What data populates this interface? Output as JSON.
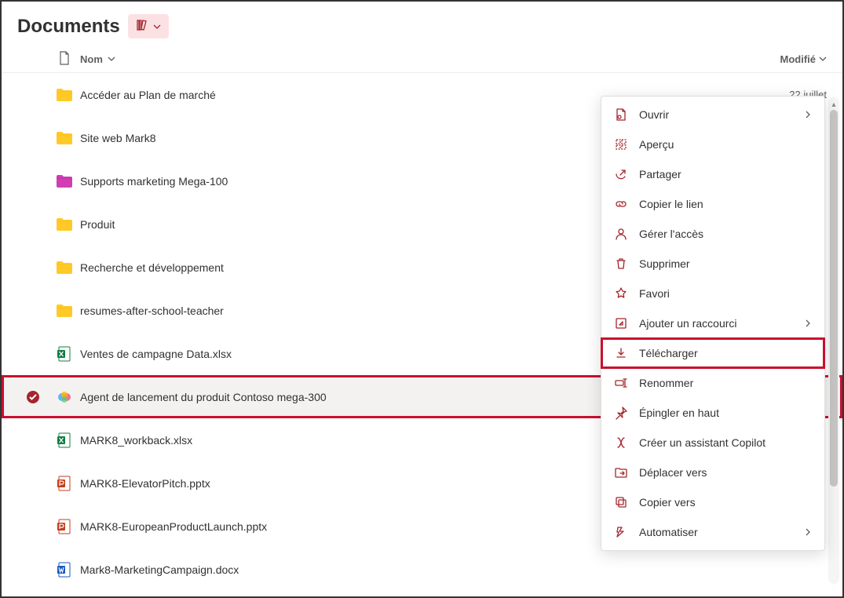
{
  "header": {
    "title": "Documents"
  },
  "columns": {
    "name": "Nom",
    "modified": "Modifié"
  },
  "rows": [
    {
      "icon": "folder-yellow",
      "name": "Accéder au Plan de marché",
      "modified": "22 juillet",
      "selected": false,
      "highlighted": false
    },
    {
      "icon": "folder-yellow",
      "name": "Site web Mark8",
      "modified": "",
      "selected": false,
      "highlighted": false
    },
    {
      "icon": "folder-magenta",
      "name": "Supports marketing Mega-100",
      "modified": "",
      "selected": false,
      "highlighted": false
    },
    {
      "icon": "folder-yellow",
      "name": "Produit",
      "modified": "",
      "selected": false,
      "highlighted": false
    },
    {
      "icon": "folder-yellow",
      "name": "Recherche et développement",
      "modified": "",
      "selected": false,
      "highlighted": false
    },
    {
      "icon": "folder-yellow",
      "name": "resumes-after-school-teacher",
      "modified": "",
      "selected": false,
      "highlighted": false
    },
    {
      "icon": "excel",
      "name": "Ventes de campagne Data.xlsx",
      "modified": "",
      "selected": false,
      "highlighted": false
    },
    {
      "icon": "copilot",
      "name": "Agent de lancement du produit Contoso mega-300",
      "modified": "",
      "selected": true,
      "highlighted": true,
      "showEllipsis": true
    },
    {
      "icon": "excel",
      "name": "MARK8_workback.xlsx",
      "modified": "",
      "selected": false,
      "highlighted": false
    },
    {
      "icon": "powerpoint",
      "name": "MARK8-ElevatorPitch.pptx",
      "modified": "",
      "selected": false,
      "highlighted": false
    },
    {
      "icon": "powerpoint",
      "name": "MARK8-EuropeanProductLaunch.pptx",
      "modified": "",
      "selected": false,
      "highlighted": false
    },
    {
      "icon": "word",
      "name": "Mark8-MarketingCampaign.docx",
      "modified": "",
      "selected": false,
      "highlighted": false
    }
  ],
  "contextMenu": {
    "items": [
      {
        "icon": "open-icon",
        "label": "Ouvrir",
        "chevron": true,
        "highlighted": false
      },
      {
        "icon": "preview-icon",
        "label": "Aperçu",
        "chevron": false,
        "highlighted": false
      },
      {
        "icon": "share-icon",
        "label": "Partager",
        "chevron": false,
        "highlighted": false
      },
      {
        "icon": "link-icon",
        "label": "Copier le lien",
        "chevron": false,
        "highlighted": false
      },
      {
        "icon": "access-icon",
        "label": "Gérer l'accès",
        "chevron": false,
        "highlighted": false
      },
      {
        "icon": "delete-icon",
        "label": "Supprimer",
        "chevron": false,
        "highlighted": false
      },
      {
        "icon": "favorite-icon",
        "label": "Favori",
        "chevron": false,
        "highlighted": false
      },
      {
        "icon": "shortcut-icon",
        "label": "Ajouter un raccourci",
        "chevron": true,
        "highlighted": false
      },
      {
        "icon": "download-icon",
        "label": "Télécharger",
        "chevron": false,
        "highlighted": true
      },
      {
        "icon": "rename-icon",
        "label": "Renommer",
        "chevron": false,
        "highlighted": false
      },
      {
        "icon": "pin-icon",
        "label": "Épingler en haut",
        "chevron": false,
        "highlighted": false
      },
      {
        "icon": "copilot-create-icon",
        "label": "Créer un assistant Copilot",
        "chevron": false,
        "highlighted": false
      },
      {
        "icon": "move-icon",
        "label": "Déplacer vers",
        "chevron": false,
        "highlighted": false
      },
      {
        "icon": "copy-icon",
        "label": "Copier vers",
        "chevron": false,
        "highlighted": false
      },
      {
        "icon": "automate-icon",
        "label": "Automatiser",
        "chevron": true,
        "highlighted": false
      }
    ]
  }
}
